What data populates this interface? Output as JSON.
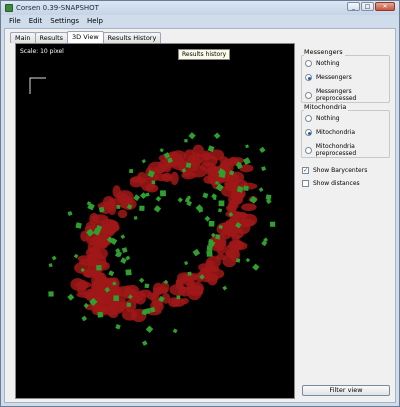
{
  "window": {
    "title": "Corsen 0.39-SNAPSHOT",
    "controls": [
      "_",
      "□",
      "✕"
    ]
  },
  "menu": [
    "File",
    "Edit",
    "Settings",
    "Help"
  ],
  "tabs": [
    {
      "label": "Main",
      "active": false
    },
    {
      "label": "Results",
      "active": false
    },
    {
      "label": "3D View",
      "active": true
    },
    {
      "label": "Results History",
      "active": false
    }
  ],
  "view3d": {
    "scale_label": "Scale: 10 pixel",
    "tooltip": "Results history"
  },
  "messengers": {
    "title": "Messengers",
    "options": [
      "Nothing",
      "Messengers",
      "Messengers preprocessed"
    ],
    "selected": 1
  },
  "mitochondria": {
    "title": "Mitochondria",
    "options": [
      "Nothing",
      "Mitochondria",
      "Mitochondria preprocessed"
    ],
    "selected": 1
  },
  "checks": {
    "barycenters": {
      "label": "Show Barycenters",
      "checked": true
    },
    "distances": {
      "label": "Show distances",
      "checked": false
    }
  },
  "filter_button": "Filter view",
  "colors": {
    "mitochondria": "#a01818",
    "messengers": "#2fa02f",
    "background": "#000000"
  }
}
